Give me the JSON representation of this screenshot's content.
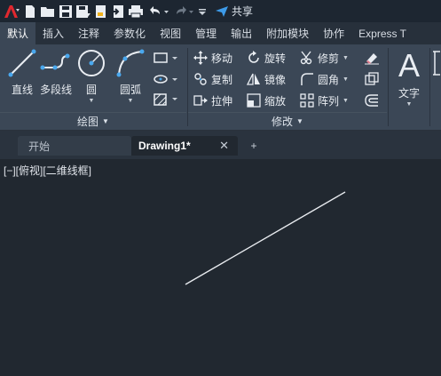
{
  "quick_access": {
    "share_label": "共享",
    "icons": [
      "app-logo-icon",
      "new-file-icon",
      "open-folder-icon",
      "save-icon",
      "save-as-icon",
      "publish-icon",
      "import-icon",
      "print-icon",
      "undo-icon",
      "redo-icon",
      "customize-icon",
      "share-icon"
    ]
  },
  "ribbon_tabs": [
    "默认",
    "插入",
    "注释",
    "参数化",
    "视图",
    "管理",
    "输出",
    "附加模块",
    "协作",
    "Express T"
  ],
  "active_tab": "默认",
  "draw_panel": {
    "title": "绘图",
    "tools": {
      "line": "直线",
      "polyline": "多段线",
      "circle": "圆",
      "arc": "圆弧"
    }
  },
  "modify_panel": {
    "title": "修改",
    "tools": {
      "move": "移动",
      "rotate": "旋转",
      "trim": "修剪",
      "copy": "复制",
      "mirror": "镜像",
      "fillet": "圆角",
      "stretch": "拉伸",
      "scale": "缩放",
      "array": "阵列"
    }
  },
  "annotation_panel": {
    "text": "文字"
  },
  "document_tabs": {
    "home": "开始",
    "drawing": "Drawing1*",
    "close_glyph": "✕",
    "new_glyph": "+"
  },
  "viewport": {
    "label": "[−][俯视][二维线框]"
  },
  "colors": {
    "canvas_bg": "#212830",
    "ribbon_bg": "#3b4756",
    "accent_blue": "#4aa8ee",
    "share_blue": "#3d9be9"
  }
}
